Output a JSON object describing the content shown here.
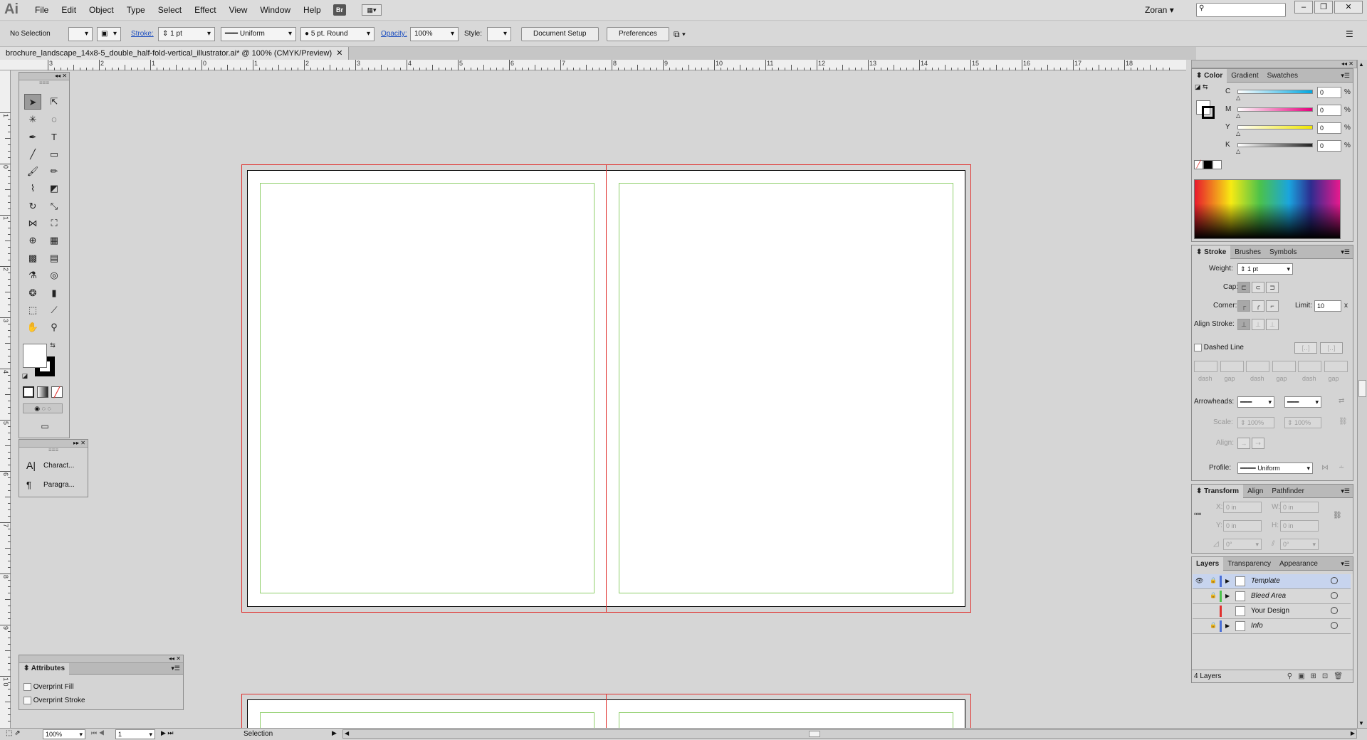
{
  "app": {
    "logo": "Ai",
    "user": "Zoran",
    "bridge": "Br"
  },
  "menu": [
    "File",
    "Edit",
    "Object",
    "Type",
    "Select",
    "Effect",
    "View",
    "Window",
    "Help"
  ],
  "control": {
    "selection": "No Selection",
    "stroke_label": "Stroke:",
    "stroke_weight": "1 pt",
    "profile": "Uniform",
    "brush": "5 pt. Round",
    "opacity_label": "Opacity:",
    "opacity": "100%",
    "style_label": "Style:",
    "doc_setup": "Document Setup",
    "prefs": "Preferences"
  },
  "doc_tab": "brochure_landscape_14x8-5_double_half-fold-vertical_illustrator.ai* @ 100% (CMYK/Preview)",
  "hruler": [
    "4",
    "3",
    "2",
    "1",
    "0",
    "1",
    "2",
    "3",
    "4",
    "5",
    "6",
    "7",
    "8",
    "9",
    "10",
    "11",
    "12",
    "13",
    "14",
    "15",
    "16",
    "17",
    "18"
  ],
  "vruler": [
    "1",
    "0",
    "1",
    "2",
    "3",
    "4",
    "5",
    "6",
    "7",
    "8",
    "9",
    "1 0"
  ],
  "type_panel": {
    "items": [
      "Charact...",
      "Paragra..."
    ]
  },
  "attributes": {
    "title": "Attributes",
    "fill": "Overprint Fill",
    "stroke": "Overprint Stroke"
  },
  "color_panel": {
    "tabs": [
      "Color",
      "Gradient",
      "Swatches"
    ],
    "channels": [
      {
        "name": "C",
        "value": "0",
        "color": "#00a7e1"
      },
      {
        "name": "M",
        "value": "0",
        "color": "#e4007c"
      },
      {
        "name": "Y",
        "value": "0",
        "color": "#f0e600"
      },
      {
        "name": "K",
        "value": "0",
        "color": "#222222"
      }
    ],
    "pct": "%"
  },
  "stroke_panel": {
    "tabs": [
      "Stroke",
      "Brushes",
      "Symbols"
    ],
    "weight_label": "Weight:",
    "weight": "1 pt",
    "cap_label": "Cap:",
    "corner_label": "Corner:",
    "limit_label": "Limit:",
    "limit": "10",
    "limit_unit": "x",
    "align_label": "Align Stroke:",
    "dashed": "Dashed Line",
    "dash_labels": [
      "dash",
      "gap",
      "dash",
      "gap",
      "dash",
      "gap"
    ],
    "arrow_label": "Arrowheads:",
    "scale_label": "Scale:",
    "scale1": "100%",
    "scale2": "100%",
    "align2_label": "Align:",
    "profile_label": "Profile:",
    "profile": "Uniform"
  },
  "transform_panel": {
    "tabs": [
      "Transform",
      "Align",
      "Pathfinder"
    ],
    "x_label": "X:",
    "x": "0 in",
    "w_label": "W:",
    "w": "0 in",
    "y_label": "Y:",
    "y": "0 in",
    "h_label": "H:",
    "h": "0 in",
    "rot": "0°",
    "shear": "0°"
  },
  "layers_panel": {
    "tabs": [
      "Layers",
      "Transparency",
      "Appearance"
    ],
    "layers": [
      {
        "name": "Template",
        "color": "#4a6fd6",
        "italic": true
      },
      {
        "name": "Bleed Area",
        "color": "#4bc24b",
        "italic": true
      },
      {
        "name": "Your Design",
        "color": "#e0312e",
        "italic": false
      },
      {
        "name": "Info",
        "color": "#4a6fd6",
        "italic": true
      }
    ],
    "count": "4 Layers"
  },
  "status": {
    "zoom": "100%",
    "page": "1",
    "tool": "Selection"
  }
}
